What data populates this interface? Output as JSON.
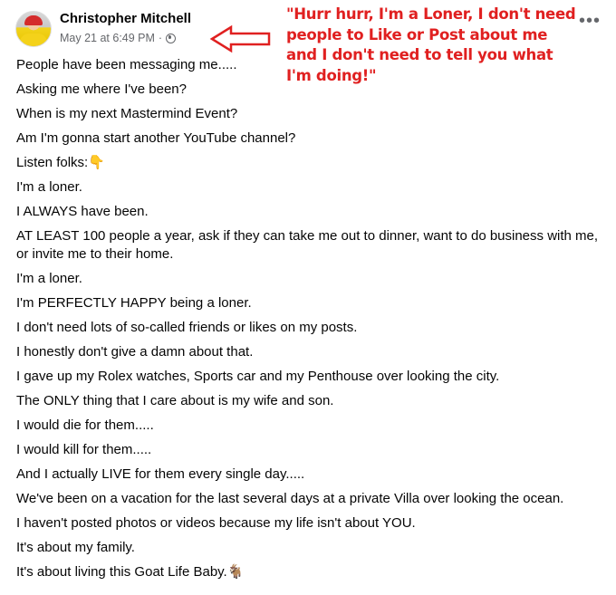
{
  "post": {
    "author": "Christopher Mitchell",
    "date": "May 21 at 6:49 PM",
    "separator": "·",
    "privacy_icon": "globe-icon",
    "more_label": "•••"
  },
  "annotation": {
    "text": "\"Hurr hurr, I'm a Loner, I don't need people to Like or Post about me and I don't need to tell you what I'm doing!\"",
    "color": "#e02020"
  },
  "lines": [
    "People have been messaging me.....",
    "Asking me where I've been?",
    "When is my next Mastermind Event?",
    "Am I'm gonna start another YouTube channel?",
    "Listen folks:👇",
    "I'm a loner.",
    "I ALWAYS have been.",
    "AT LEAST 100 people a year, ask if they can take me out to dinner, want to do business with me, or invite me to their home.",
    "I'm a loner.",
    "I'm PERFECTLY HAPPY being a loner.",
    "I don't need lots of so-called friends or likes on my posts.",
    "I honestly don't give a damn about that.",
    "I gave up my Rolex watches, Sports car and my Penthouse over looking the city.",
    "The ONLY thing that I care about is my wife and son.",
    "I would die for them.....",
    "I would kill for them.....",
    "And I actually LIVE for them every single day.....",
    "We've been on a vacation for the last several days at a private Villa over looking the ocean.",
    "I haven't posted photos or videos because my life isn't about YOU.",
    "It's about my family.",
    "It's about living this Goat Life Baby.🐐"
  ]
}
